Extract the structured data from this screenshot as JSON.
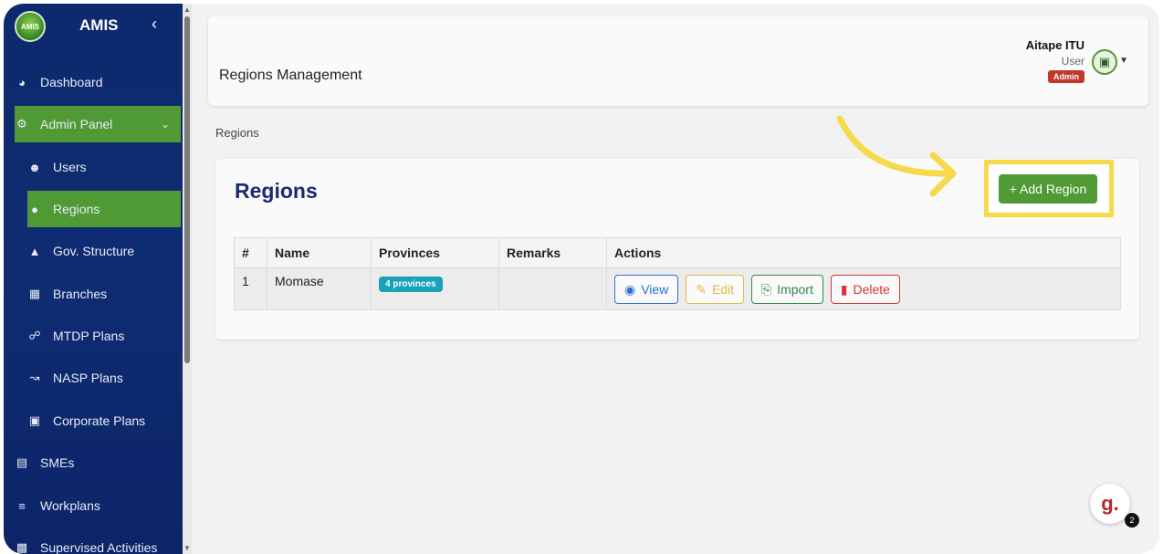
{
  "sidebar": {
    "brand": "AMIS",
    "logo_text": "AMIS",
    "collapse_icon": "chevron-left-icon",
    "items": [
      {
        "label": "Dashboard",
        "icon": "dashboard-icon"
      },
      {
        "label": "Admin Panel",
        "icon": "gear-icon"
      },
      {
        "label": "Users",
        "icon": "users-icon"
      },
      {
        "label": "Regions",
        "icon": "map-pin-icon"
      },
      {
        "label": "Gov. Structure",
        "icon": "sitemap-icon"
      },
      {
        "label": "Branches",
        "icon": "building-icon"
      },
      {
        "label": "MTDP Plans",
        "icon": "network-icon"
      },
      {
        "label": "NASP Plans",
        "icon": "line-chart-icon"
      },
      {
        "label": "Corporate Plans",
        "icon": "briefcase-icon"
      },
      {
        "label": "SMEs",
        "icon": "store-icon"
      },
      {
        "label": "Workplans",
        "icon": "list-check-icon"
      },
      {
        "label": "Supervised Activities",
        "icon": "clipboard-icon"
      }
    ]
  },
  "header": {
    "title": "Regions Management",
    "user_name": "Aitape ITU",
    "user_role": "User",
    "user_badge": "Admin"
  },
  "breadcrumb": "Regions",
  "card": {
    "title": "Regions",
    "add_button": "+ Add Region"
  },
  "table": {
    "columns": [
      "#",
      "Name",
      "Provinces",
      "Remarks",
      "Actions"
    ],
    "rows": [
      {
        "index": "1",
        "name": "Momase",
        "provinces": "4 provinces",
        "remarks": ""
      }
    ],
    "actions": {
      "view": "View",
      "edit": "Edit",
      "import": "Import",
      "delete": "Delete"
    }
  },
  "chat": {
    "letter": "g.",
    "count": "2"
  },
  "colors": {
    "sidebar_bg": "#0d2a6e",
    "accent_green": "#4f9a35",
    "highlight_yellow": "#f7d94c",
    "title_navy": "#1a2a6c"
  }
}
